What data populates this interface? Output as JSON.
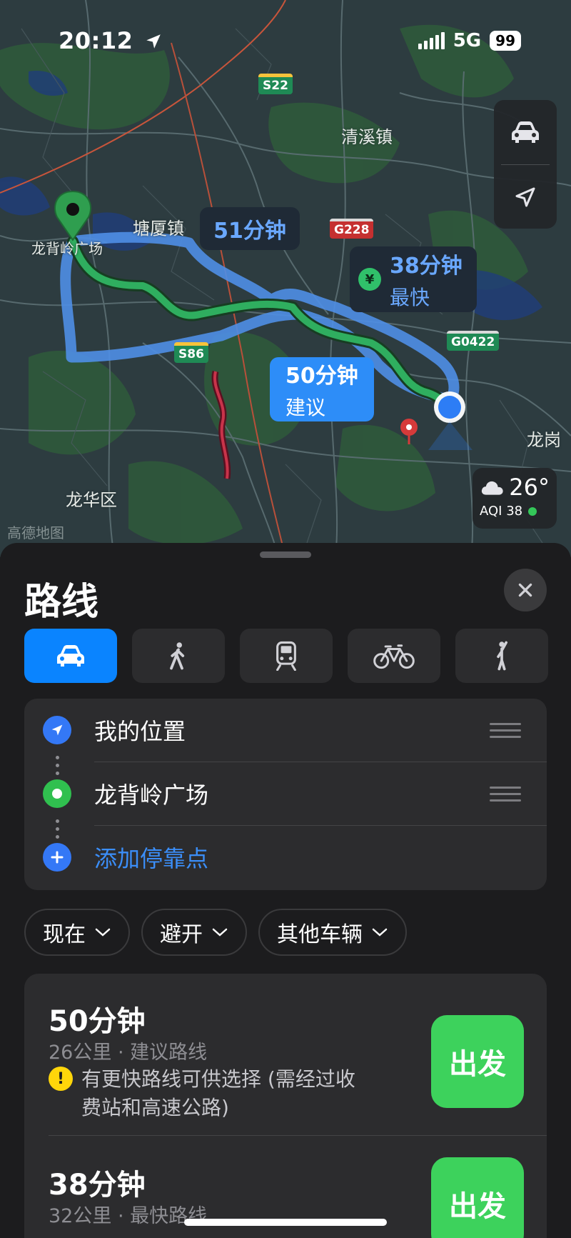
{
  "status_bar": {
    "time": "20:12",
    "network": "5G",
    "battery": "99"
  },
  "map": {
    "place_labels": {
      "town_qingxi": "清溪镇",
      "town_tangxia": "塘厦镇",
      "district_longhua": "龙华区",
      "longgang": "龙岗",
      "destination": "龙背岭广场"
    },
    "road_shields": {
      "s22": "S22",
      "g228": "G228",
      "s86": "S86",
      "g0422": "G0422"
    },
    "route_bubbles": {
      "alt_time": "51分钟",
      "fast_time": "38分钟",
      "fast_tag": "最快",
      "fast_icon": "¥",
      "suggested_time": "50分钟",
      "suggested_tag": "建议"
    },
    "weather": {
      "temperature": "26°",
      "aqi": "AQI 38"
    },
    "watermark": "高德地图",
    "colors": {
      "route_suggested": "#2fae5f",
      "route_alt": "#4f8fe6",
      "accent": "#0a84ff"
    }
  },
  "sheet": {
    "title": "路线",
    "close_icon": "close-icon",
    "modes": [
      {
        "name": "drive",
        "icon": "car-icon",
        "active": true
      },
      {
        "name": "walk",
        "icon": "walk-icon",
        "active": false
      },
      {
        "name": "transit",
        "icon": "train-icon",
        "active": false
      },
      {
        "name": "cycle",
        "icon": "bicycle-icon",
        "active": false
      },
      {
        "name": "ride",
        "icon": "hail-icon",
        "active": false
      }
    ],
    "stops": {
      "origin": "我的位置",
      "destination": "龙背岭广场",
      "add_stop": "添加停靠点"
    },
    "filters": {
      "depart": "现在",
      "avoid": "避开",
      "vehicle": "其他车辆"
    },
    "routes": [
      {
        "time": "50分钟",
        "detail": "26公里 · 建议路线",
        "note": "有更快路线可供选择 (需经过收费站和高速公路)",
        "go": "出发"
      },
      {
        "time": "38分钟",
        "detail": "32公里 · 最快路线",
        "go": "出发"
      }
    ]
  }
}
